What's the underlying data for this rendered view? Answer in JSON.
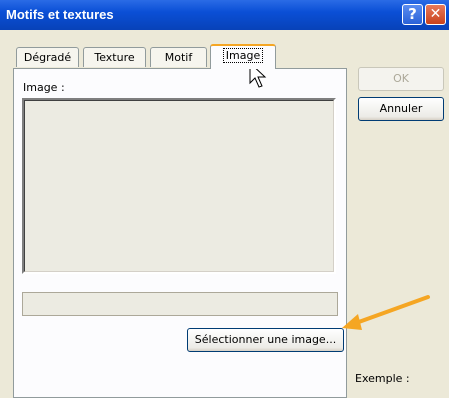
{
  "window": {
    "title": "Motifs et textures",
    "help_glyph": "?",
    "close_glyph": "✕"
  },
  "tabs": [
    {
      "label": "Dégradé"
    },
    {
      "label": "Texture"
    },
    {
      "label": "Motif"
    },
    {
      "label": "Image",
      "active": true
    }
  ],
  "panel": {
    "image_label": "Image :",
    "select_button_label": "Sélectionner une image..."
  },
  "buttons": {
    "ok_label": "OK",
    "cancel_label": "Annuler"
  },
  "sample_label": "Exemple :",
  "colors": {
    "titlebar": "#0a4fd6",
    "dialog_background": "#ece9d8",
    "annotation_arrow": "#f5a623"
  }
}
